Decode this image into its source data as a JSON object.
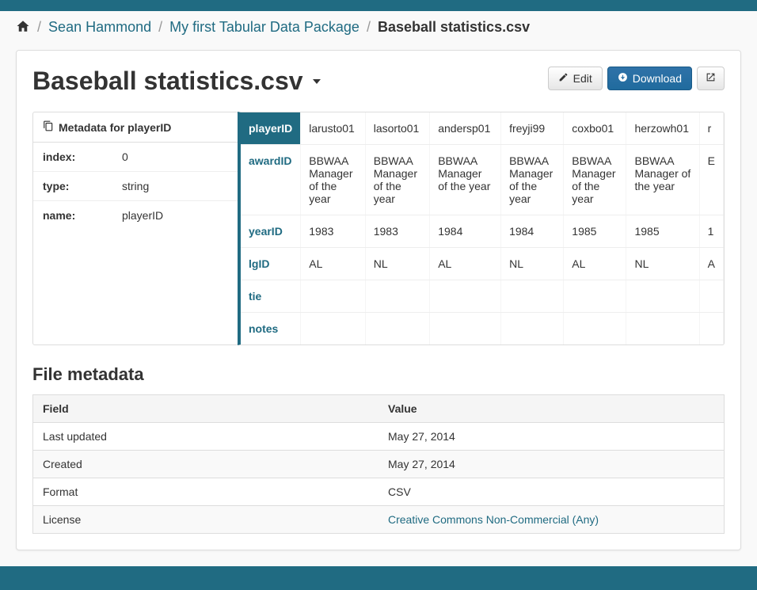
{
  "breadcrumb": {
    "items": [
      {
        "label": "Sean Hammond"
      },
      {
        "label": "My first Tabular Data Package"
      }
    ],
    "active": "Baseball statistics.csv"
  },
  "page": {
    "title": "Baseball statistics.csv"
  },
  "actions": {
    "edit": "Edit",
    "download": "Download"
  },
  "metadata": {
    "header": "Metadata for playerID",
    "rows": [
      {
        "k": "index:",
        "v": "0"
      },
      {
        "k": "type:",
        "v": "string"
      },
      {
        "k": "name:",
        "v": "playerID"
      }
    ]
  },
  "dataTable": {
    "rows": [
      {
        "header": "playerID",
        "active": true,
        "cells": [
          "larusto01",
          "lasorto01",
          "andersp01",
          "freyji99",
          "coxbo01",
          "herzowh01",
          "r"
        ]
      },
      {
        "header": "awardID",
        "cells": [
          "BBWAA Manager of the year",
          "BBWAA Manager of the year",
          "BBWAA Manager of the year",
          "BBWAA Manager of the year",
          "BBWAA Manager of the year",
          "BBWAA Manager of the year",
          "E"
        ]
      },
      {
        "header": "yearID",
        "cells": [
          "1983",
          "1983",
          "1984",
          "1984",
          "1985",
          "1985",
          "1"
        ]
      },
      {
        "header": "lgID",
        "cells": [
          "AL",
          "NL",
          "AL",
          "NL",
          "AL",
          "NL",
          "A"
        ]
      },
      {
        "header": "tie",
        "cells": [
          "",
          "",
          "",
          "",
          "",
          "",
          ""
        ]
      },
      {
        "header": "notes",
        "cells": [
          "",
          "",
          "",
          "",
          "",
          "",
          ""
        ]
      }
    ]
  },
  "fileMetadata": {
    "title": "File metadata",
    "headers": {
      "field": "Field",
      "value": "Value"
    },
    "rows": [
      {
        "field": "Last updated",
        "value": "May 27, 2014",
        "link": false
      },
      {
        "field": "Created",
        "value": "May 27, 2014",
        "link": false
      },
      {
        "field": "Format",
        "value": "CSV",
        "link": false
      },
      {
        "field": "License",
        "value": "Creative Commons Non-Commercial (Any)",
        "link": true
      }
    ]
  }
}
